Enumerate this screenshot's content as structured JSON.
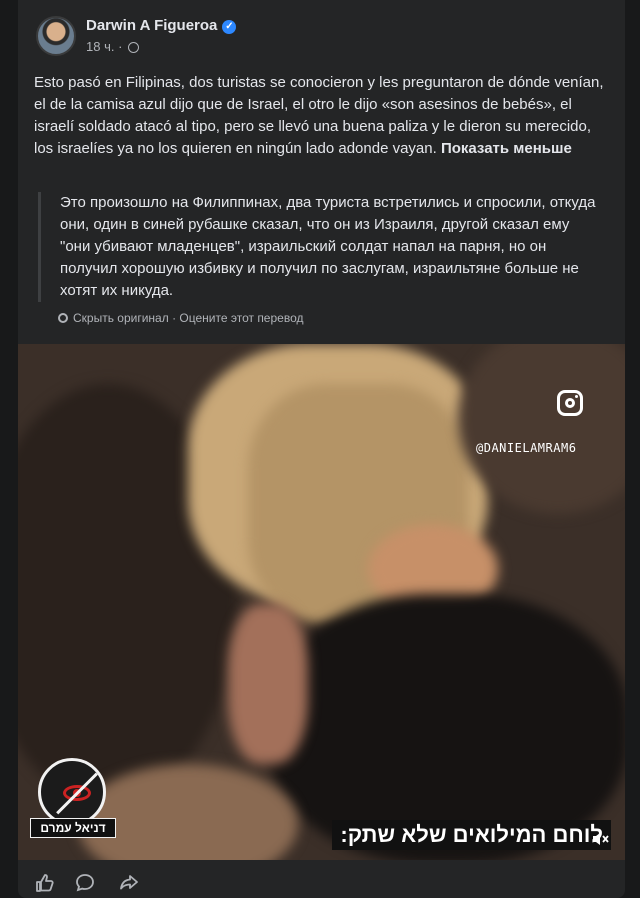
{
  "post": {
    "author": "Darwin A Figueroa",
    "time": "18 ч.",
    "more_label": "···",
    "text": "Esto pasó en Filipinas, dos turistas se conocieron y les preguntaron de dónde venían, el de la camisa azul dijo que de Israel, el otro le dijo «son asesinos de bebés», el israelí soldado atacó al tipo, pero se llevó una buena paliza y le dieron su merecido, los israelíes ya no los quieren en ningún lado adonde vayan.",
    "see_less": "Показать меньше",
    "translation": "Это произошло на Филиппинах, два туриста встретились и спросили, откуда они, один в синей рубашке сказал, что он из Израиля, другой сказал ему \"они убивают младенцев\", израильский солдат напал на парня, но он получил хорошую избивку и получил по заслугам, израильтяне больше не хотят их никуда.",
    "hide_original": "Скрыть оригинал",
    "separator": " · ",
    "rate_translation": "Оцените этот перевод"
  },
  "video": {
    "handle": "@DANIELAMRAM6",
    "logo_name": "דניאל עמרם",
    "caption": "לוחם המילואים שלא שתק:"
  },
  "icons": {
    "verified": "verified-badge-icon",
    "privacy": "globe-icon",
    "instagram": "instagram-icon",
    "mute": "speaker-muted-icon",
    "like": "thumbs-up-icon",
    "comment": "comment-icon",
    "share": "share-icon"
  },
  "colors": {
    "background": "#18191a",
    "card": "#242526",
    "text": "#e4e6eb",
    "secondary_text": "#b0b3b8",
    "accent": "#2d88ff"
  }
}
